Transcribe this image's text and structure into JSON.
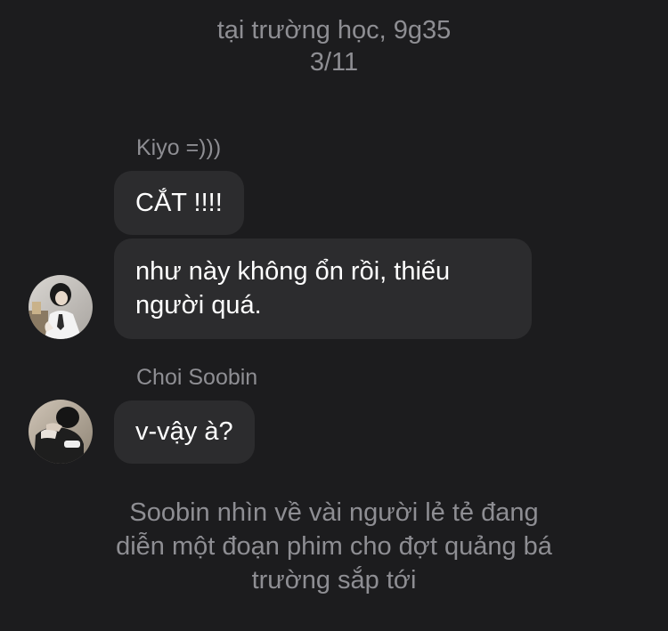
{
  "header": {
    "line1": "tại trường học, 9g35",
    "line2": "3/11"
  },
  "messages": [
    {
      "sender": "Kiyo =)))",
      "bubbles": [
        {
          "lines": [
            "CẮT !!!!"
          ]
        },
        {
          "lines": [
            "như này không ổn rồi, thiếu",
            "người quá."
          ]
        }
      ],
      "avatar": "avatar-photo"
    },
    {
      "sender": "Choi Soobin",
      "bubbles": [
        {
          "lines": [
            "v-vậy à?"
          ]
        }
      ],
      "avatar": "avatar-photo"
    }
  ],
  "narration": {
    "lines": [
      "Soobin nhìn về vài người lẻ tẻ đang",
      "diễn một đoạn phim cho đợt quảng bá",
      "trường sắp tới"
    ]
  },
  "colors": {
    "background": "#1c1c1e",
    "bubble": "#2c2c2e",
    "secondary_text": "#8e8e93",
    "primary_text": "#ffffff"
  }
}
